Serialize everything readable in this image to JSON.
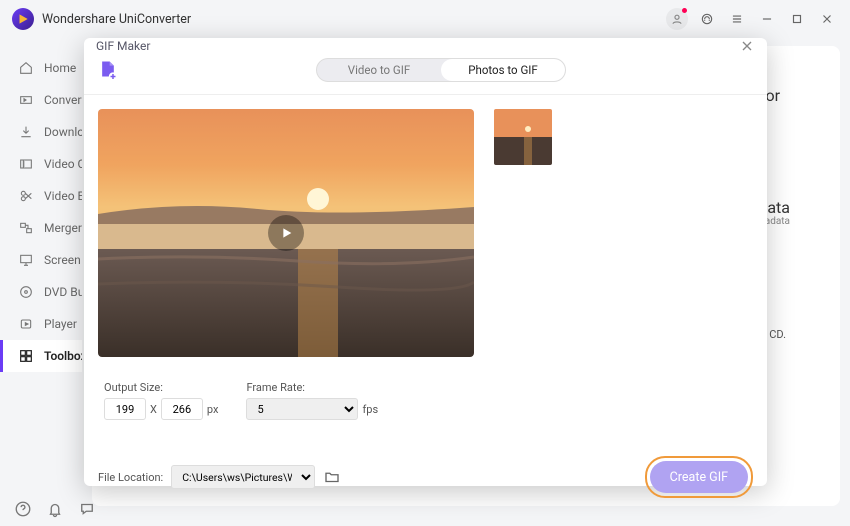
{
  "app": {
    "title": "Wondershare UniConverter"
  },
  "sidebar": {
    "items": [
      {
        "label": "Home"
      },
      {
        "label": "Converter"
      },
      {
        "label": "Downloader"
      },
      {
        "label": "Video Compressor"
      },
      {
        "label": "Video Editor"
      },
      {
        "label": "Merger"
      },
      {
        "label": "Screen Recorder"
      },
      {
        "label": "DVD Burner"
      },
      {
        "label": "Player"
      },
      {
        "label": "Toolbox"
      }
    ]
  },
  "bg": {
    "w1": "tor",
    "w2": "data",
    "w3": "etadata",
    "w4": "CD."
  },
  "modal": {
    "title": "GIF Maker",
    "tab_video": "Video to GIF",
    "tab_photos": "Photos to GIF",
    "output_size_label": "Output Size:",
    "frame_rate_label": "Frame Rate:",
    "width": "199",
    "height": "266",
    "x": "X",
    "px": "px",
    "fps_value": "5",
    "fps_unit": "fps",
    "file_location_label": "File Location:",
    "file_location_value": "C:\\Users\\ws\\Pictures\\Wondershare",
    "create_btn": "Create GIF"
  }
}
